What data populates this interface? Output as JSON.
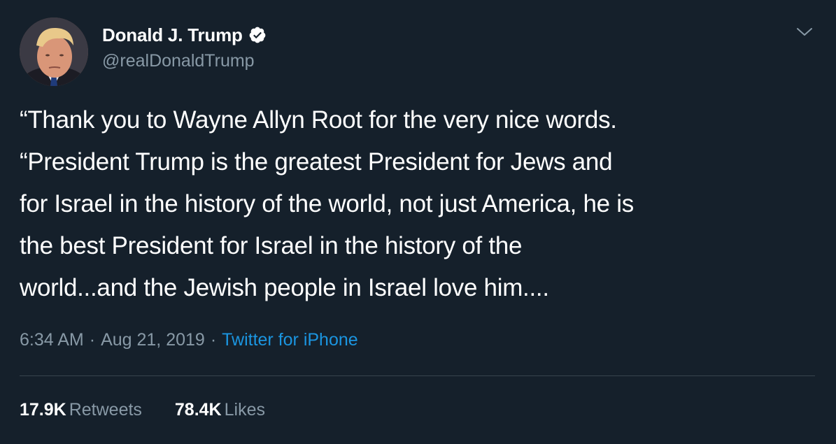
{
  "author": {
    "display_name": "Donald J. Trump",
    "handle": "@realDonaldTrump",
    "verified": true,
    "avatar_icon": "profile-photo",
    "verified_icon": "verified-badge-icon"
  },
  "menu": {
    "icon": "chevron-down-icon"
  },
  "tweet": {
    "lines": [
      "“Thank you to Wayne Allyn Root for the very nice words.",
      "“President Trump is the greatest President for Jews and",
      "for Israel in the history of the world, not just America, he is",
      "the best President for Israel in the history of the",
      "world...and the Jewish people in Israel love him...."
    ]
  },
  "meta": {
    "time": "6:34 AM",
    "date": "Aug 21, 2019",
    "separator": "·",
    "source": "Twitter for iPhone"
  },
  "stats": {
    "retweets_count": "17.9K",
    "retweets_label": "Retweets",
    "likes_count": "78.4K",
    "likes_label": "Likes"
  },
  "colors": {
    "background": "#15202b",
    "primary_text": "#ffffff",
    "secondary_text": "#8899a6",
    "link": "#1b95e0",
    "divider": "#38444d",
    "verified": "#ffffff"
  }
}
